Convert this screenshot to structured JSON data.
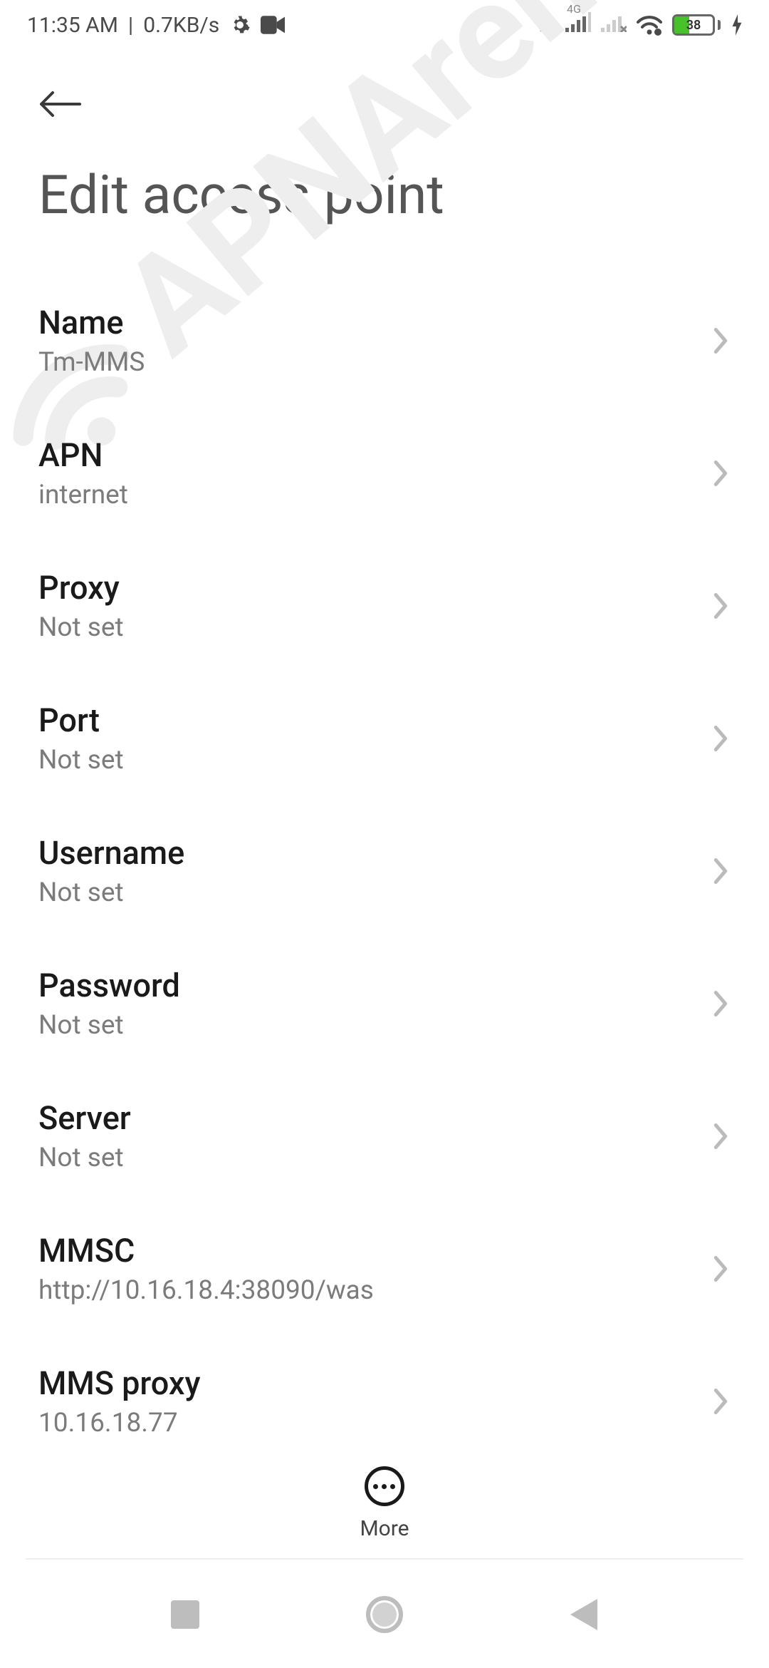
{
  "statusbar": {
    "time": "11:35 AM",
    "separator": "|",
    "speed": "0.7KB/s",
    "network_label": "4G",
    "battery_pct": 38
  },
  "watermark": {
    "text": "APNArena"
  },
  "header": {
    "title": "Edit access point"
  },
  "items": [
    {
      "label": "Name",
      "value": "Tm-MMS"
    },
    {
      "label": "APN",
      "value": "internet"
    },
    {
      "label": "Proxy",
      "value": "Not set"
    },
    {
      "label": "Port",
      "value": "Not set"
    },
    {
      "label": "Username",
      "value": "Not set"
    },
    {
      "label": "Password",
      "value": "Not set"
    },
    {
      "label": "Server",
      "value": "Not set"
    },
    {
      "label": "MMSC",
      "value": "http://10.16.18.4:38090/was"
    },
    {
      "label": "MMS proxy",
      "value": "10.16.18.77"
    }
  ],
  "more": {
    "label": "More"
  }
}
